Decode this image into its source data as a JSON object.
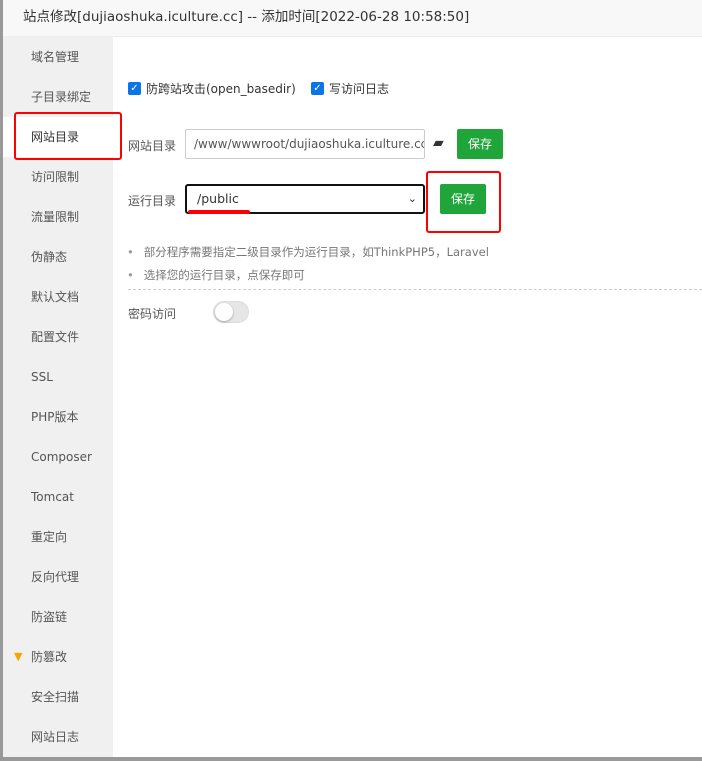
{
  "title": "站点修改[dujiaoshuka.iculture.cc] -- 添加时间[2022-06-28 10:58:50]",
  "sidebar": {
    "items": [
      {
        "label": "域名管理"
      },
      {
        "label": "子目录绑定"
      },
      {
        "label": "网站目录",
        "active": true
      },
      {
        "label": "访问限制"
      },
      {
        "label": "流量限制"
      },
      {
        "label": "伪静态"
      },
      {
        "label": "默认文档"
      },
      {
        "label": "配置文件"
      },
      {
        "label": "SSL"
      },
      {
        "label": "PHP版本"
      },
      {
        "label": "Composer"
      },
      {
        "label": "Tomcat"
      },
      {
        "label": "重定向"
      },
      {
        "label": "反向代理"
      },
      {
        "label": "防盗链"
      },
      {
        "label": "防篡改",
        "icon": "gem-icon"
      },
      {
        "label": "安全扫描"
      },
      {
        "label": "网站日志"
      }
    ]
  },
  "main": {
    "checkbox_basedir": {
      "label": "防跨站攻击(open_basedir)",
      "checked": true
    },
    "checkbox_log": {
      "label": "写访问日志",
      "checked": true
    },
    "site_dir": {
      "label": "网站目录",
      "value": "/www/wwwroot/dujiaoshuka.iculture.cc",
      "save": "保存"
    },
    "run_dir": {
      "label": "运行目录",
      "value": "/public",
      "save": "保存"
    },
    "tips": [
      "部分程序需要指定二级目录作为运行目录，如ThinkPHP5，Laravel",
      "选择您的运行目录，点保存即可"
    ],
    "password_access": {
      "label": "密码访问",
      "enabled": false
    }
  },
  "colors": {
    "accent": "#20a53a",
    "highlight": "#ff0000",
    "checkbox": "#0a75e8",
    "gem": "#f6a400"
  }
}
